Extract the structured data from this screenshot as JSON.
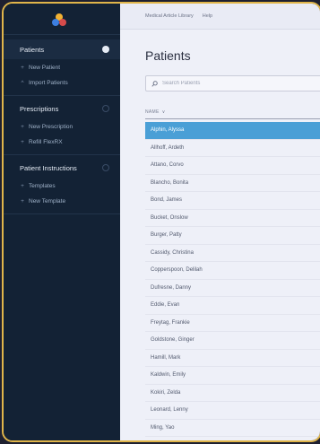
{
  "topbar": {
    "links": [
      "Medical Article Library",
      "Help"
    ]
  },
  "sidebar": {
    "sections": [
      {
        "title": "Patients",
        "active": true,
        "items": [
          {
            "prefix": "+",
            "label": "New Patient"
          },
          {
            "prefix": "^",
            "label": "Import Patients"
          }
        ]
      },
      {
        "title": "Prescriptions",
        "active": false,
        "items": [
          {
            "prefix": "+",
            "label": "New Prescription"
          },
          {
            "prefix": "+",
            "label": "Refill FlexRX"
          }
        ]
      },
      {
        "title": "Patient Instructions",
        "active": false,
        "items": [
          {
            "prefix": "+",
            "label": "Templates"
          },
          {
            "prefix": "+",
            "label": "New Template"
          }
        ]
      }
    ]
  },
  "main": {
    "title": "Patients",
    "search_placeholder": "Search Patients",
    "column_header": "NAME",
    "sort_indicator": "∨",
    "selected_index": 0,
    "patients": [
      "Alphin, Alyssa",
      "Allhoff, Ardeth",
      "Attano, Corvo",
      "Blancho, Bonita",
      "Bond, James",
      "Bucket, Onslow",
      "Burger, Patty",
      "Cassidy, Christina",
      "Copperspoon, Delilah",
      "Dufresne, Danny",
      "Eddie, Evan",
      "Freytag, Frankie",
      "Goldstone, Ginger",
      "Hamill, Mark",
      "Kaldwin, Emily",
      "Kokiri, Zelda",
      "Leonard, Lenny",
      "Ming, Yao"
    ]
  },
  "colors": {
    "accent": "#4a9fd6",
    "frame_border": "#e0b54a",
    "sidebar": "#132235"
  }
}
